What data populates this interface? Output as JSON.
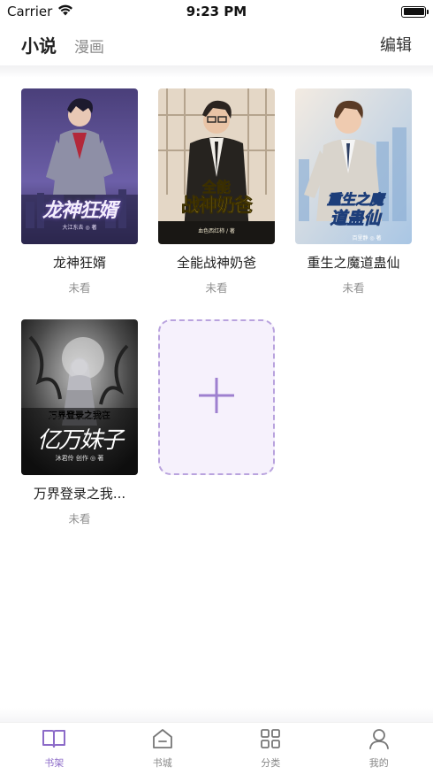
{
  "status_bar": {
    "carrier": "Carrier",
    "time": "9:23 PM"
  },
  "top_nav": {
    "tabs": [
      {
        "label": "小说",
        "active": true
      },
      {
        "label": "漫画",
        "active": false
      }
    ],
    "edit_label": "编辑"
  },
  "shelf": {
    "books": [
      {
        "title": "龙神狂婿",
        "status": "未看",
        "cover_text": "龙神狂婿",
        "cover_author": "大江东去 ◎ 著"
      },
      {
        "title": "全能战神奶爸",
        "status": "未看",
        "cover_text_top": "全能",
        "cover_text": "战神奶爸",
        "cover_author": "血色西红柿 / 著"
      },
      {
        "title": "重生之魔道蛊仙",
        "status": "未看",
        "cover_text_top": "重生之魔",
        "cover_text": "道蛊仙",
        "cover_author": "百里静 ◎ 著"
      },
      {
        "title": "万界登录之我...",
        "status": "未看",
        "cover_text_top": "万界登录之我在",
        "cover_text": "亿万妹子",
        "cover_author": "沐君伶 创作 ◎ 著"
      }
    ],
    "add_icon": "plus-icon"
  },
  "tab_bar": {
    "items": [
      {
        "label": "书架",
        "icon": "book-open-icon",
        "active": true
      },
      {
        "label": "书城",
        "icon": "home-icon",
        "active": false
      },
      {
        "label": "分类",
        "icon": "grid-icon",
        "active": false
      },
      {
        "label": "我的",
        "icon": "user-icon",
        "active": false
      }
    ]
  },
  "colors": {
    "accent": "#8c6bc8",
    "add_card_border": "#b9a3de",
    "add_card_bg": "#f6f1fc"
  }
}
